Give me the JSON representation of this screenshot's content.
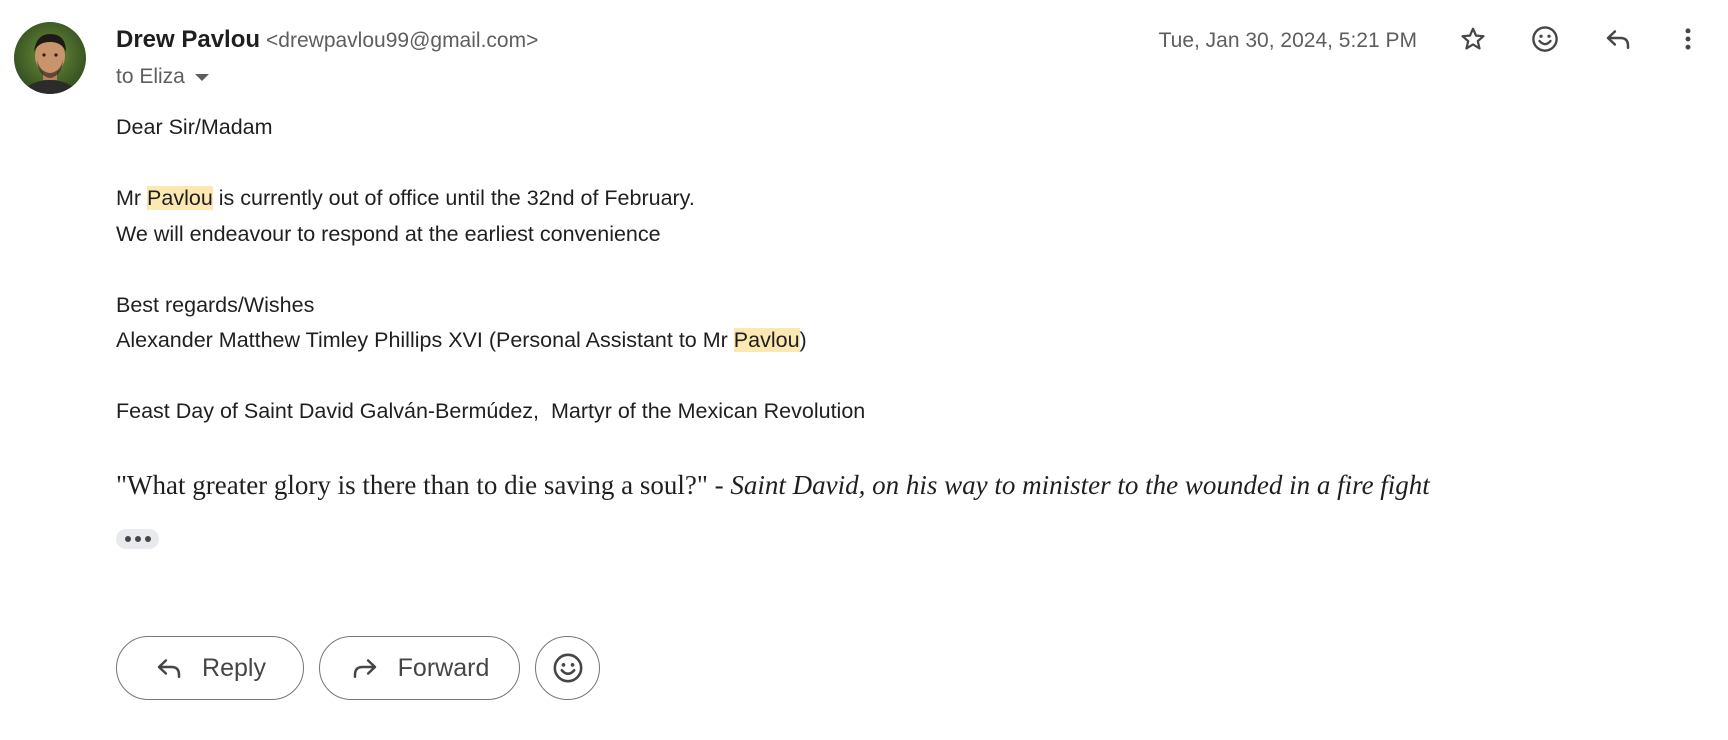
{
  "sender": {
    "name": "Drew Pavlou",
    "email": "<drewpavlou99@gmail.com>"
  },
  "recipient": {
    "label": "to Eliza"
  },
  "date": "Tue, Jan 30, 2024, 5:21 PM",
  "header_actions": [
    {
      "icon": "star-icon",
      "label": "Star"
    },
    {
      "icon": "emoji-icon",
      "label": "Add reaction"
    },
    {
      "icon": "reply-icon",
      "label": "Reply"
    },
    {
      "icon": "more-vert-icon",
      "label": "More"
    }
  ],
  "body": {
    "greeting": "Dear Sir/Madam",
    "line1_prefix": "Mr ",
    "line1_highlight": "Pavlou",
    "line1_suffix": " is currently out of office until the 32nd of February.",
    "line2": "We will endeavour to respond at the earliest convenience",
    "signoff": "Best regards/Wishes",
    "signature_prefix": "Alexander Matthew Timley Phillips XVI (Personal Assistant to Mr ",
    "signature_highlight": "Pavlou",
    "signature_suffix": ")",
    "feast_day": "Feast Day of Saint David Galván-Bermúdez,  Martyr of the Mexican Revolution",
    "quote_text": "\"What greater glory is there than to die saving a soul?\" - ",
    "quote_attribution": "Saint David, on his way to minister to the wounded in a fire fight"
  },
  "highlight_color": "#fce8b2",
  "footer": {
    "reply_label": "Reply",
    "forward_label": "Forward"
  }
}
